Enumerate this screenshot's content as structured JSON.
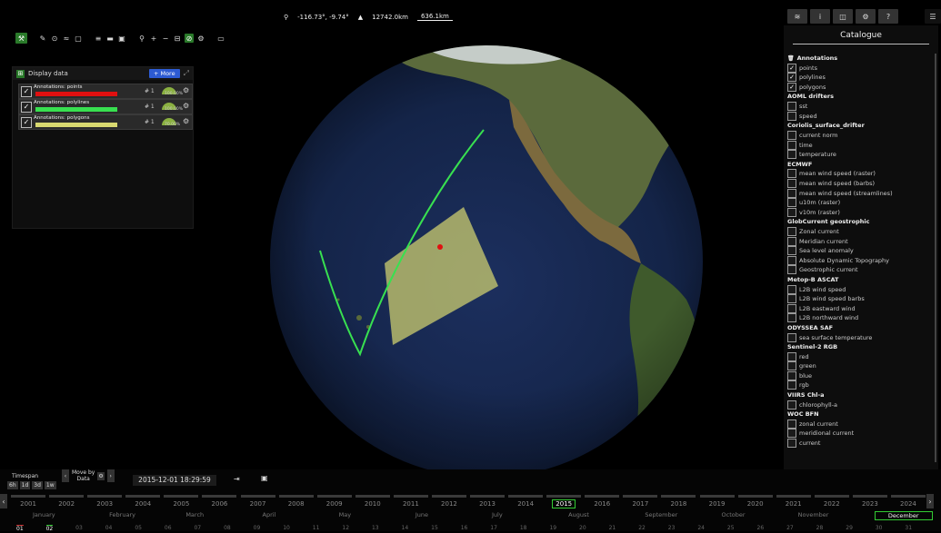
{
  "topbar": {
    "position": "-116.73°, -9.74°",
    "altitude": "12742.0km",
    "scale": "636.1km"
  },
  "toolbar": {
    "icons": [
      "map-tools-icon",
      "pencil-icon",
      "circle-icon",
      "polyline-icon",
      "rectangle-icon",
      "layers-icon",
      "folder-icon",
      "save-icon",
      "zoom-icon",
      "plus-icon",
      "minus-icon",
      "ruler-icon",
      "globe-icon",
      "settings-icon",
      "panel-icon"
    ]
  },
  "display_panel": {
    "title": "Display data",
    "more_label": "+ More",
    "layers": [
      {
        "name": "Annotations: points",
        "color": "#e01010",
        "index": "# 1",
        "pct": "100.00%"
      },
      {
        "name": "Annotations: polylines",
        "color": "#38e050",
        "index": "# 1",
        "pct": "100.00%"
      },
      {
        "name": "Annotations: polygons",
        "color": "#d8d870",
        "index": "# 1",
        "pct": "70.00%"
      }
    ]
  },
  "catalogue": {
    "title": "Catalogue",
    "groups": [
      {
        "name": "Annotations",
        "items": [
          {
            "label": "points",
            "checked": true
          },
          {
            "label": "polylines",
            "checked": true
          },
          {
            "label": "polygons",
            "checked": true
          }
        ]
      },
      {
        "name": "AOML drifters",
        "items": [
          {
            "label": "sst",
            "checked": false
          },
          {
            "label": "speed",
            "checked": false
          }
        ]
      },
      {
        "name": "Coriolis_surface_drifter",
        "items": [
          {
            "label": "current norm",
            "checked": false
          },
          {
            "label": "time",
            "checked": false
          },
          {
            "label": "temperature",
            "checked": false
          }
        ]
      },
      {
        "name": "ECMWF",
        "items": [
          {
            "label": "mean wind speed (raster)",
            "checked": false
          },
          {
            "label": "mean wind speed (barbs)",
            "checked": false
          },
          {
            "label": "mean wind speed (streamlines)",
            "checked": false
          },
          {
            "label": "u10m (raster)",
            "checked": false
          },
          {
            "label": "v10m (raster)",
            "checked": false
          }
        ]
      },
      {
        "name": "GlobCurrent geostrophic",
        "items": [
          {
            "label": "Zonal current",
            "checked": false
          },
          {
            "label": "Meridian current",
            "checked": false
          },
          {
            "label": "Sea level anomaly",
            "checked": false
          },
          {
            "label": "Absolute Dynamic Topography",
            "checked": false
          },
          {
            "label": "Geostrophic current",
            "checked": false
          }
        ]
      },
      {
        "name": "Metop-B ASCAT",
        "items": [
          {
            "label": "L2B wind speed",
            "checked": false
          },
          {
            "label": "L2B wind speed barbs",
            "checked": false
          },
          {
            "label": "L2B eastward wind",
            "checked": false
          },
          {
            "label": "L2B northward wind",
            "checked": false
          }
        ]
      },
      {
        "name": "ODYSSEA SAF",
        "items": [
          {
            "label": "sea surface temperature",
            "checked": false
          }
        ]
      },
      {
        "name": "Sentinel-2 RGB",
        "items": [
          {
            "label": "red",
            "checked": false
          },
          {
            "label": "green",
            "checked": false
          },
          {
            "label": "blue",
            "checked": false
          },
          {
            "label": "rgb",
            "checked": false
          }
        ]
      },
      {
        "name": "VIIRS Chl-a",
        "items": [
          {
            "label": "chlorophyll-a",
            "checked": false
          }
        ]
      },
      {
        "name": "WOC BFN",
        "items": [
          {
            "label": "zonal current",
            "checked": false
          },
          {
            "label": "meridional current",
            "checked": false
          },
          {
            "label": "current",
            "checked": false
          }
        ]
      }
    ]
  },
  "timeline": {
    "timespan_label": "Timespan",
    "timespan_options": [
      "6h",
      "1d",
      "3d",
      "1w"
    ],
    "moveby_label": "Move by",
    "moveby_value": "Data",
    "datetime": "2015-12-01 18:29:59",
    "years": [
      "2001",
      "2002",
      "2003",
      "2004",
      "2005",
      "2006",
      "2007",
      "2008",
      "2009",
      "2010",
      "2011",
      "2012",
      "2013",
      "2014",
      "2015",
      "2016",
      "2017",
      "2018",
      "2019",
      "2020",
      "2021",
      "2022",
      "2023",
      "2024"
    ],
    "selected_year": "2015",
    "months": [
      "January",
      "February",
      "March",
      "April",
      "May",
      "June",
      "July",
      "August",
      "September",
      "October",
      "November",
      "December"
    ],
    "selected_month": "December",
    "days": [
      "01",
      "02",
      "03",
      "04",
      "05",
      "06",
      "07",
      "08",
      "09",
      "10",
      "11",
      "12",
      "13",
      "14",
      "15",
      "16",
      "17",
      "18",
      "19",
      "20",
      "21",
      "22",
      "23",
      "24",
      "25",
      "26",
      "27",
      "28",
      "29",
      "30",
      "31"
    ]
  }
}
